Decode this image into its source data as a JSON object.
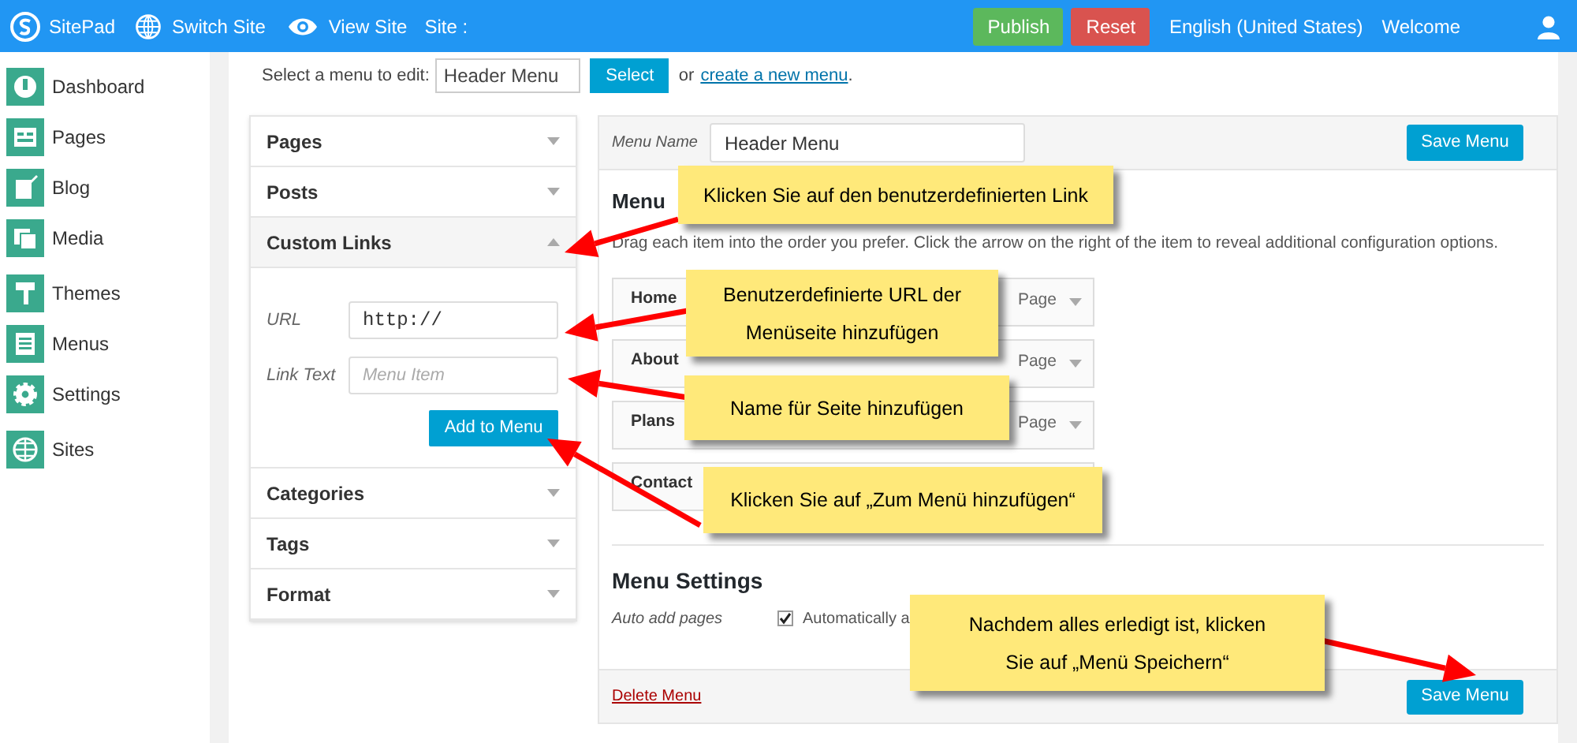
{
  "topbar": {
    "brand": "SitePad",
    "links": [
      "Switch Site",
      "View Site"
    ],
    "site_label": "Site :",
    "publish": "Publish",
    "reset": "Reset",
    "language": "English (United States)",
    "welcome": "Welcome"
  },
  "sidebar": {
    "items": [
      {
        "label": "Dashboard"
      },
      {
        "label": "Pages"
      },
      {
        "label": "Blog"
      },
      {
        "label": "Media"
      },
      {
        "label": "Themes"
      },
      {
        "label": "Menus"
      },
      {
        "label": "Settings"
      },
      {
        "label": "Sites"
      }
    ]
  },
  "menu_select": {
    "label": "Select a menu to edit:",
    "value": "Header Menu",
    "button": "Select",
    "or": "or",
    "create_link": "create a new menu",
    "end": "."
  },
  "accordion": [
    {
      "title": "Pages",
      "expanded": false
    },
    {
      "title": "Posts",
      "expanded": false
    },
    {
      "title": "Custom Links",
      "expanded": true
    },
    {
      "title": "Categories",
      "expanded": false
    },
    {
      "title": "Tags",
      "expanded": false
    },
    {
      "title": "Format",
      "expanded": false
    }
  ],
  "custom_links": {
    "url_label": "URL",
    "url_value": "http://",
    "text_label": "Link Text",
    "text_placeholder": "Menu Item",
    "button": "Add to Menu"
  },
  "menu_editor": {
    "name_label": "Menu Name",
    "name_value": "Header Menu",
    "save": "Save Menu",
    "structure_heading": "Menu",
    "instructions": "Drag each item into the order you prefer. Click the arrow on the right of the item to reveal additional configuration options.",
    "items": [
      {
        "title": "Home",
        "type": "Page"
      },
      {
        "title": "About",
        "type": "Page"
      },
      {
        "title": "Plans",
        "type": "Page"
      },
      {
        "title": "Contact"
      }
    ],
    "settings_heading": "Menu Settings",
    "auto_add_label": "Auto add pages",
    "auto_add_checked": true,
    "auto_add_text": "Automatically a",
    "delete": "Delete Menu",
    "save_bottom": "Save Menu"
  },
  "callouts": [
    {
      "text": "Klicken Sie auf den benutzerdefinierten Link"
    },
    {
      "text": "Benutzerdefinierte URL der Menüseite hinzufügen"
    },
    {
      "text": "Name für Seite hinzufügen"
    },
    {
      "text": "Klicken Sie auf „Zum Menü hinzufügen“"
    },
    {
      "text": "Nachdem alles erledigt ist, klicken Sie auf „Menü Speichern“"
    }
  ]
}
